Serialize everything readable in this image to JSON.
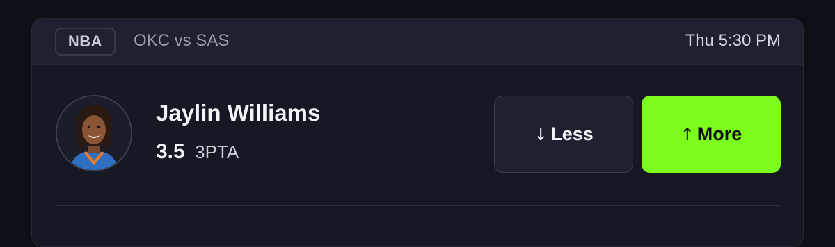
{
  "header": {
    "league": "NBA",
    "matchup": "OKC vs SAS",
    "time": "Thu 5:30 PM"
  },
  "player": {
    "name": "Jaylin Williams",
    "line_value": "3.5",
    "stat_type": "3PTA"
  },
  "actions": {
    "less_label": "Less",
    "less_arrow": "↓",
    "more_label": "More",
    "more_arrow": "↑"
  },
  "colors": {
    "background": "#0d0f17",
    "card": "#161923",
    "header": "#1e2130",
    "more_accent": "#7cfc1c"
  },
  "icons": {
    "less": "arrow-down-icon",
    "more": "arrow-up-icon"
  }
}
